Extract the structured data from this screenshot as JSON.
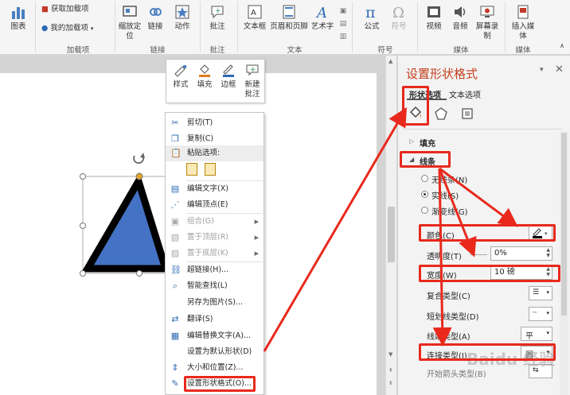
{
  "ribbon": {
    "chart_label": "图表",
    "get_addins": "获取加载项",
    "my_addins": "我的加载项",
    "group_addins": "加载项",
    "zoom_label": "缩放定位",
    "link_label": "链接",
    "action_label": "动作",
    "group_links": "链接",
    "comment_label": "批注",
    "group_comment": "批注",
    "textbox_label": "文本框",
    "header_footer_label": "页眉和页脚",
    "wordart_label": "艺术字",
    "group_text": "文本",
    "equation_label": "公式",
    "symbol_label": "符号",
    "group_symbols": "符号",
    "video_label": "视频",
    "audio_label": "音频",
    "screen_record_label": "屏幕录制",
    "group_media": "媒体",
    "insert_media_label": "插入媒体",
    "group_media2": "媒体"
  },
  "mini_toolbar": {
    "style": "样式",
    "fill": "填充",
    "border": "边框",
    "new_comment": "新建批注"
  },
  "context_menu": {
    "cut": "剪切(T)",
    "copy": "复制(C)",
    "paste_options": "粘贴选项:",
    "edit_text": "编辑文字(X)",
    "edit_points": "编辑顶点(E)",
    "group": "组合(G)",
    "bring_front": "置于顶层(R)",
    "send_back": "置于底层(K)",
    "hyperlink": "超链接(H)...",
    "smart_lookup": "智能查找(L)",
    "save_as_picture": "另存为图片(S)...",
    "translate": "翻译(S)",
    "edit_alt_text": "编辑替换文字(A)...",
    "set_default": "设置为默认形状(D)",
    "size_position": "大小和位置(Z)...",
    "format_shape": "设置形状格式(O)..."
  },
  "pane": {
    "title": "设置形状格式",
    "tab_shape": "形状选项",
    "tab_text": "文本选项",
    "fill_section": "填充",
    "line_section": "线条",
    "no_line": "无线条(N)",
    "solid_line": "实线(S)",
    "gradient_line": "渐变线(G)",
    "color_label": "颜色(C)",
    "transparency_label": "透明度(T)",
    "transparency_value": "0%",
    "width_label": "宽度(W)",
    "width_value": "10 磅",
    "compound_label": "复合类型(C)",
    "dash_label": "短划线类型(D)",
    "cap_label": "线端类型(A)",
    "cap_value": "平",
    "join_label": "连接类型(J)",
    "join_value": "圆",
    "arrow_begin_label": "开始箭头类型(B)"
  },
  "colors": {
    "accent": "#e8291c",
    "shape_fill": "#4472c4",
    "pane_title": "#c43e1c"
  },
  "watermark": "Baidu 经验"
}
